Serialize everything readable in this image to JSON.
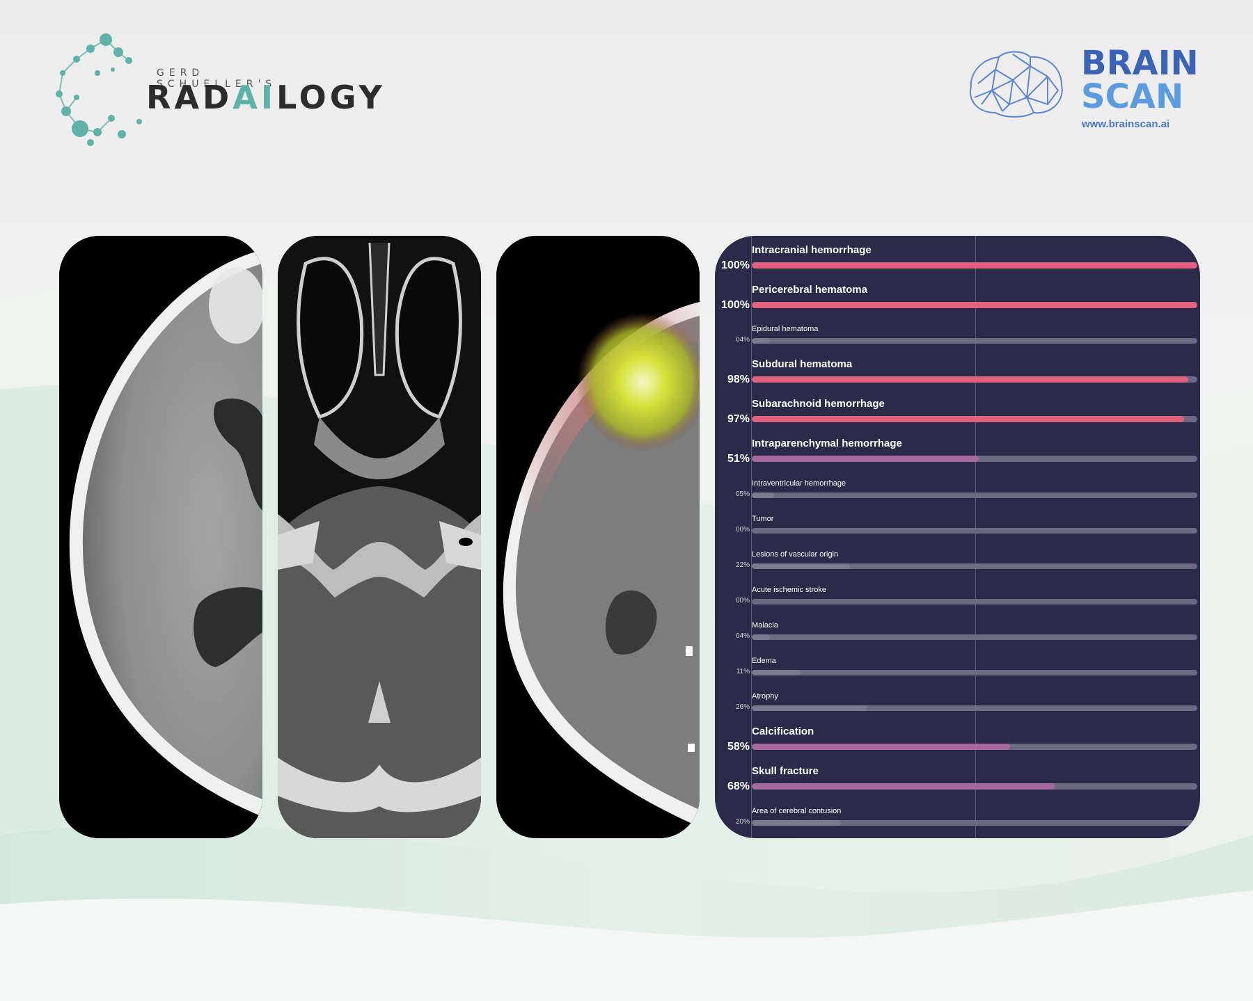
{
  "colors": {
    "accent_teal": "#5fb3a6",
    "brand_blue": "#3a63b8",
    "brand_light_blue": "#5b9be0",
    "chart_background": "#2b2a48",
    "track": "#6b6a82",
    "fill_high": "#e0607e",
    "fill_mid": "#a76a9c",
    "fill_low": "#7a7990"
  },
  "header": {
    "left_logo": {
      "pre_title": "GERD SCHUELLER'S",
      "title_part1": "RAD",
      "title_highlight": "AI",
      "title_part2": "LOGY",
      "icon": "molecule-network-icon"
    },
    "right_logo": {
      "line1": "BRAIN",
      "line2": "SCAN",
      "url": "www.brainscan.ai",
      "icon": "brain-mesh-icon"
    }
  },
  "scans": [
    {
      "name": "axial-ct-brain-window"
    },
    {
      "name": "axial-ct-bone-window"
    },
    {
      "name": "axial-ct-heatmap-overlay"
    }
  ],
  "chart_data": {
    "type": "bar",
    "orientation": "horizontal",
    "categories": [
      "Intracranial hemorrhage",
      "Pericerebral hematoma",
      "Epidural hematoma",
      "Subdural hematoma",
      "Subarachnoid hemorrhage",
      "Intraparenchymal hemorrhage",
      "Intraventricular hemorrhage",
      "Tumor",
      "Lesions of vascular origin",
      "Acute ischemic stroke",
      "Malacia",
      "Edema",
      "Atrophy",
      "Calcification",
      "Skull fracture",
      "Area of cerebral contusion"
    ],
    "labels": [
      "100%",
      "100%",
      "04%",
      "98%",
      "97%",
      "51%",
      "05%",
      "00%",
      "22%",
      "00%",
      "04%",
      "11%",
      "26%",
      "58%",
      "68%",
      "20%"
    ],
    "values": [
      100,
      100,
      4,
      98,
      97,
      51,
      5,
      0,
      22,
      0,
      4,
      11,
      26,
      58,
      68,
      20
    ],
    "xlim": [
      0,
      100
    ],
    "grid": true
  }
}
